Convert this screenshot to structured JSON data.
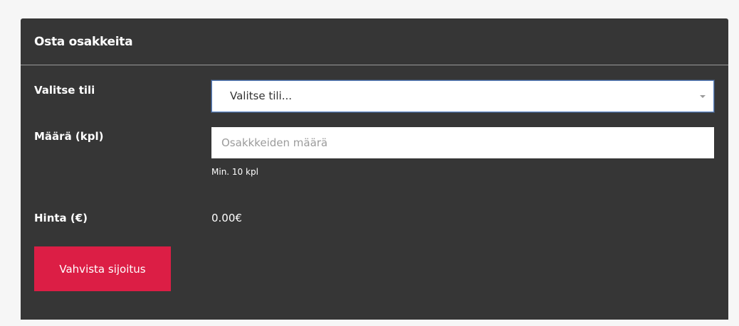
{
  "panel": {
    "title": "Osta osakkeita"
  },
  "form": {
    "account": {
      "label": "Valitse tili",
      "selected": "Valitse tili..."
    },
    "quantity": {
      "label": "Määrä (kpl)",
      "placeholder": "Osakkkeiden määrä",
      "value": "",
      "hint": "Min. 10 kpl"
    },
    "price": {
      "label": "Hinta (€)",
      "value": "0.00€"
    },
    "submit_label": "Vahvista sijoitus"
  },
  "colors": {
    "panel_bg": "#363636",
    "accent": "#dc1e45",
    "page_bg": "#f6f6f6",
    "focus_border": "#5b84c4"
  },
  "icons": {
    "select_arrow": "chevron-down-icon"
  }
}
